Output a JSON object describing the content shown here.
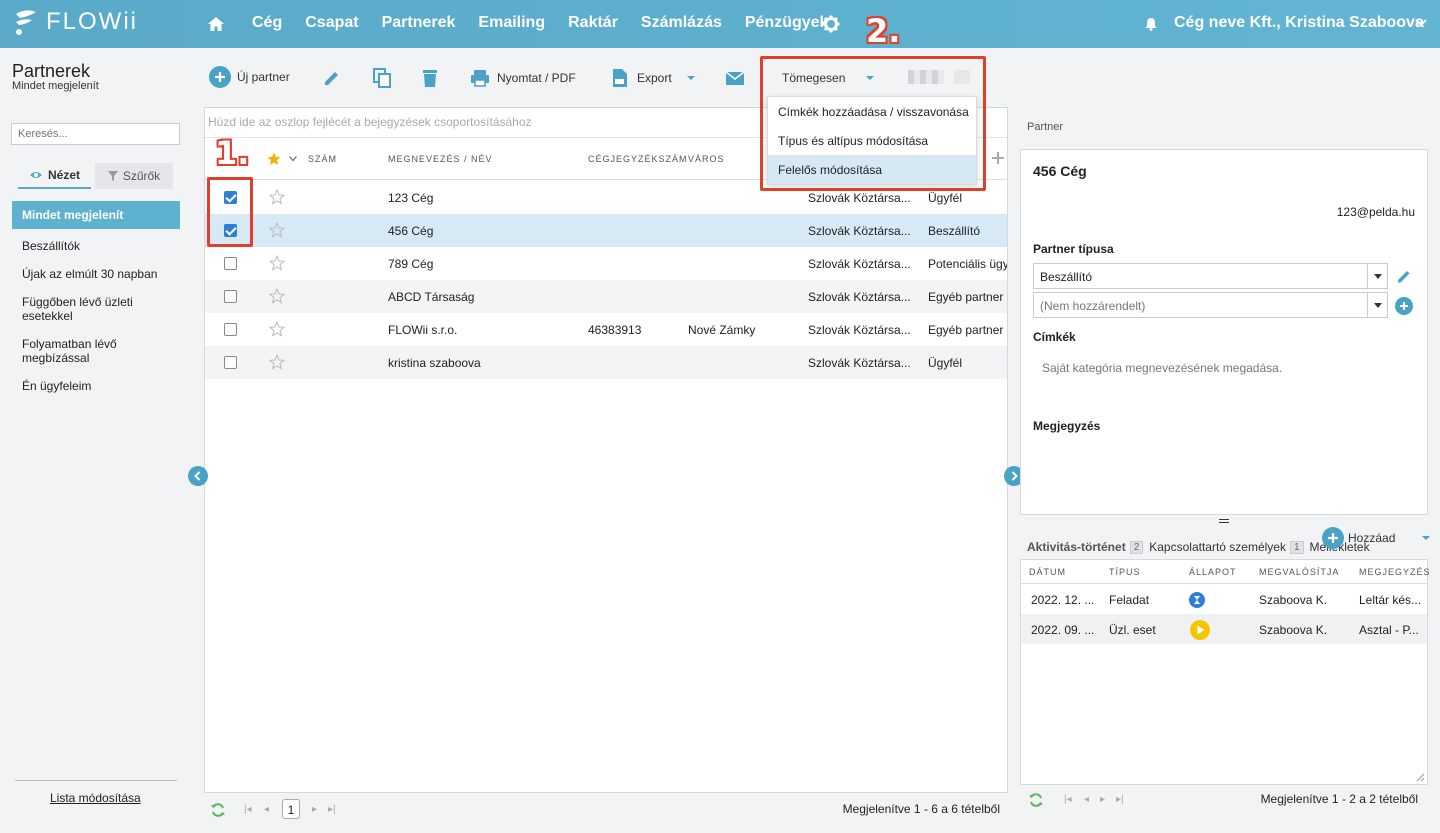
{
  "nav": {
    "logo": "FLOWii",
    "items": [
      "Cég",
      "Csapat",
      "Partnerek",
      "Emailing",
      "Raktár",
      "Számlázás",
      "Pénzügyek"
    ],
    "user": "Cég neve Kft., Kristina Szaboova"
  },
  "annotations": {
    "one": "1.",
    "two": "2."
  },
  "left": {
    "title": "Partnerek",
    "subtitle": "Mindet megjelenít",
    "search_placeholder": "Keresés...",
    "tabs": {
      "view": "Nézet",
      "filters": "Szűrők"
    },
    "items": [
      "Mindet megjelenít",
      "Beszállítók",
      "Újak az elmúlt 30 napban",
      "Függőben lévő üzleti esetekkel",
      "Folyamatban lévő megbízással",
      "Én ügyfeleim"
    ],
    "bottom_link": "Lista módosítása"
  },
  "toolbar": {
    "new_partner": "Új partner",
    "print": "Nyomtat / PDF",
    "export": "Export",
    "bulk": "Tömegesen"
  },
  "dropdown": {
    "items": [
      "Címkék hozzáadása / visszavonása",
      "Típus és altípus módosítása",
      "Felelős módosítása"
    ]
  },
  "grid": {
    "group_hint": "Húzd ide az oszlop fejlécét a bejegyzések csoportosításához",
    "headers": {
      "number": "Szám",
      "name": "Megnevezés / Név",
      "regno": "Cégjegyzékszám",
      "city": "Város"
    },
    "rows": [
      {
        "name": "123 Cég",
        "regno": "",
        "city": "",
        "country": "Szlovák Köztársa...",
        "type": "Ügyfél",
        "checked": true
      },
      {
        "name": "456 Cég",
        "regno": "",
        "city": "",
        "country": "Szlovák Köztársa...",
        "type": "Beszállító",
        "checked": true
      },
      {
        "name": "789 Cég",
        "regno": "",
        "city": "",
        "country": "Szlovák Köztársa...",
        "type": "Potenciális ügy",
        "checked": false
      },
      {
        "name": "ABCD Társaság",
        "regno": "",
        "city": "",
        "country": "Szlovák Köztársa...",
        "type": "Egyéb partner",
        "checked": false
      },
      {
        "name": "FLOWii s.r.o.",
        "regno": "46383913",
        "city": "Nové Zámky",
        "country": "Szlovák Köztársa...",
        "type": "Egyéb partner",
        "checked": false
      },
      {
        "name": "kristina szaboova",
        "regno": "",
        "city": "",
        "country": "Szlovák Köztársa...",
        "type": "Ügyfél",
        "checked": false
      }
    ],
    "page": "1",
    "pager_info": "Megjelenítve 1 - 6 a 6 tételből"
  },
  "partner": {
    "section_label": "Partner",
    "name": "456 Cég",
    "email": "123@pelda.hu",
    "type_label": "Partner típusa",
    "type_value": "Beszállító",
    "subtype_placeholder": "(Nem hozzárendelt)",
    "tags_label": "Címkék",
    "tags_hint": "Saját kategória megnevezésének megadása.",
    "note_label": "Megjegyzés"
  },
  "activity": {
    "tabs": [
      {
        "label": "Aktivitás-történet",
        "count": "2"
      },
      {
        "label": "Kapcsolattartó személyek",
        "count": "1"
      },
      {
        "label": "Mellékletek",
        "count": ""
      }
    ],
    "add": "Hozzáad",
    "headers": [
      "Dátum",
      "Típus",
      "Állapot",
      "Megvalósítja",
      "Megjegyzés"
    ],
    "rows": [
      {
        "date": "2022. 12. ...",
        "type": "Feladat",
        "owner": "Szaboova K.",
        "note": "Leltár kés..."
      },
      {
        "date": "2022. 09. ...",
        "type": "Üzl. eset",
        "owner": "Szaboova K.",
        "note": "Asztal - P..."
      }
    ],
    "pager_info": "Megjelenítve 1 - 2 a 2 tételből"
  },
  "colors": {
    "accent": "#5eb2d0",
    "annotation": "#e0402a",
    "selected_row": "#d7e9f5"
  }
}
